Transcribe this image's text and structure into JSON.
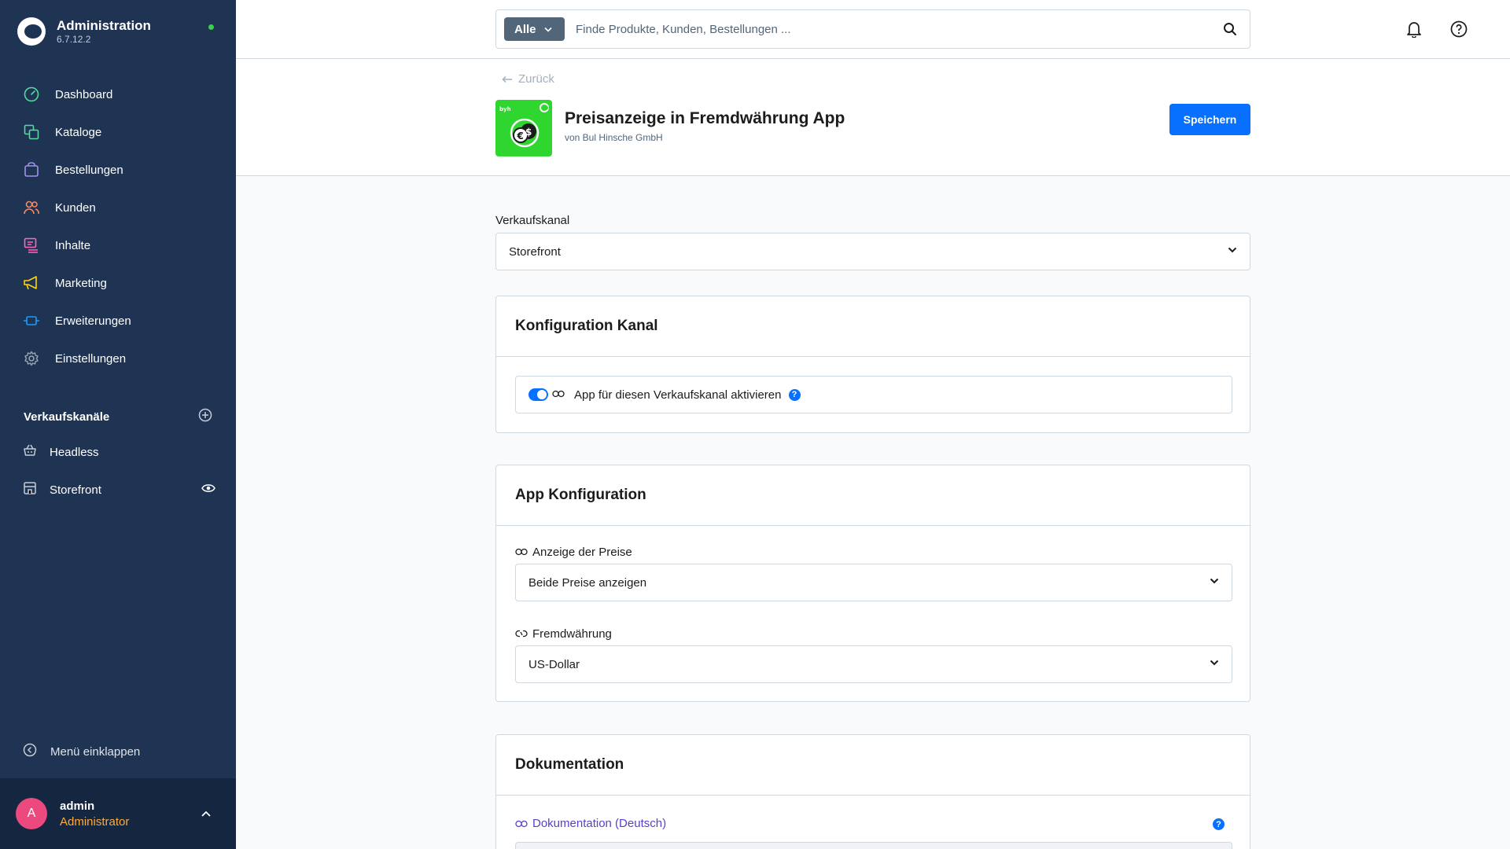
{
  "sidebar": {
    "brand_title": "Administration",
    "brand_version": "6.7.12.2",
    "nav": [
      {
        "label": "Dashboard",
        "icon": "dashboard-icon",
        "color": "#57d9a3"
      },
      {
        "label": "Kataloge",
        "icon": "catalog-icon",
        "color": "#57d9a3"
      },
      {
        "label": "Bestellungen",
        "icon": "orders-icon",
        "color": "#a092f0"
      },
      {
        "label": "Kunden",
        "icon": "customers-icon",
        "color": "#f88962"
      },
      {
        "label": "Inhalte",
        "icon": "content-icon",
        "color": "#ff68b4"
      },
      {
        "label": "Marketing",
        "icon": "marketing-icon",
        "color": "#ffd700"
      },
      {
        "label": "Erweiterungen",
        "icon": "extensions-icon",
        "color": "#189eff"
      },
      {
        "label": "Einstellungen",
        "icon": "settings-icon",
        "color": "#9aa8b5"
      }
    ],
    "sales_channels_title": "Verkaufskanäle",
    "sales_channels": [
      {
        "label": "Headless"
      },
      {
        "label": "Storefront"
      }
    ],
    "collapse_label": "Menü einklappen"
  },
  "user": {
    "initial": "A",
    "name": "admin",
    "role": "Administrator"
  },
  "search": {
    "type_label": "Alle",
    "placeholder": "Finde Produkte, Kunden, Bestellungen ..."
  },
  "header": {
    "back_label": "Zurück",
    "app_title": "Preisanzeige in Fremdwährung App",
    "app_vendor": "von Bul Hinsche GmbH",
    "save_label": "Speichern"
  },
  "sales_channel": {
    "label": "Verkaufskanal",
    "value": "Storefront"
  },
  "card_channel": {
    "title": "Konfiguration Kanal",
    "toggle_label": "App für diesen Verkaufskanal aktivieren",
    "toggle_on": true
  },
  "card_app": {
    "title": "App Konfiguration",
    "fields": [
      {
        "label": "Anzeige der Preise",
        "value": "Beide Preise anzeigen"
      },
      {
        "label": "Fremdwährung",
        "value": "US-Dollar"
      }
    ]
  },
  "card_docs": {
    "title": "Dokumentation",
    "link_label": "Dokumentation (Deutsch)"
  },
  "colors": {
    "sidebar_bg": "#1f3353",
    "accent": "#0870ff",
    "user_role": "#ffab3b",
    "avatar": "#ec4a7f",
    "online": "#37d046",
    "app_icon_bg": "#2fd62f"
  }
}
